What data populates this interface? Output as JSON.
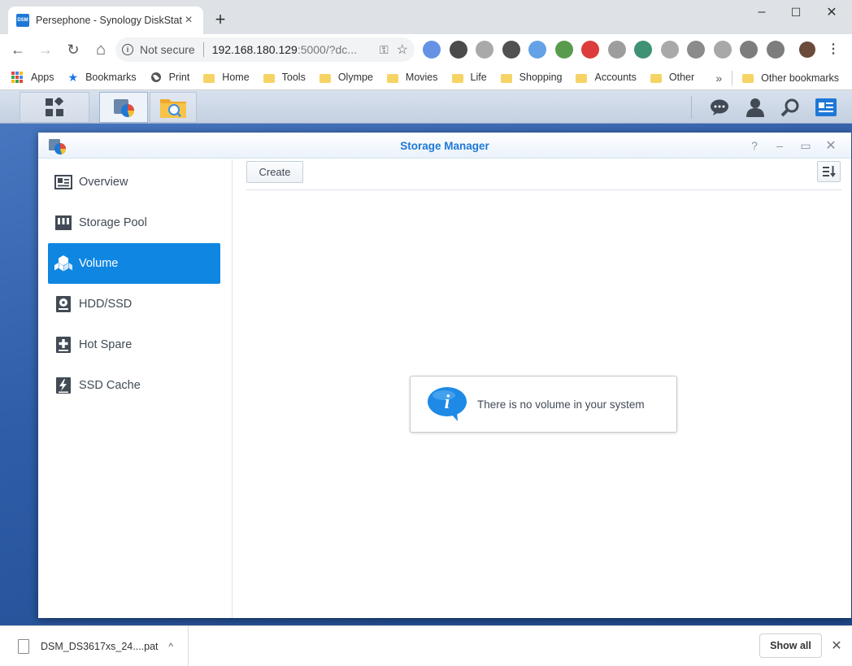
{
  "browser": {
    "tab_title": "Persephone - Synology DiskStation",
    "tab_favicon_label": "DSM",
    "tab_close": "×",
    "new_tab": "+",
    "window_controls": [
      "–",
      "☐",
      "✕"
    ],
    "nav": {
      "back": "←",
      "forward": "→",
      "reload": "↻",
      "home": "⌂"
    },
    "security_label": "Not secure",
    "url_host": "192.168.180.129",
    "url_rest": ":5000/?dc...",
    "key_icon": "⚿",
    "star_icon": "☆",
    "menu_icon": "⋮",
    "extensions": [
      {
        "icon": "google-translate-icon",
        "color": "#4a7fe0"
      },
      {
        "icon": "amazon-icon",
        "color": "#2b2b2b"
      },
      {
        "icon": "hand-icon",
        "color": "#9a9a9a"
      },
      {
        "icon": "sb-icon",
        "color": "#333333"
      },
      {
        "icon": "pulse-icon",
        "color": "#4a90e2"
      },
      {
        "icon": "globe-badge-icon",
        "color": "#3c8a2e"
      },
      {
        "icon": "opera-icon",
        "color": "#d61a1a"
      },
      {
        "icon": "search-doc-icon",
        "color": "#8c8c8c"
      },
      {
        "icon": "s-green-icon",
        "color": "#1d7f5a"
      },
      {
        "icon": "window-icon",
        "color": "#9a9a9a"
      },
      {
        "icon": "recycle-icon",
        "color": "#777777"
      },
      {
        "icon": "skype-icon",
        "color": "#999999"
      },
      {
        "icon": "puzzle-icon",
        "color": "#666666"
      },
      {
        "icon": "cast-icon",
        "color": "#666666"
      }
    ]
  },
  "bookmarks": {
    "items": [
      "Apps",
      "Bookmarks",
      "Print",
      "Home",
      "Tools",
      "Olympe",
      "Movies",
      "Life",
      "Shopping",
      "Accounts",
      "Other"
    ],
    "overflow": "»",
    "other_bookmarks": "Other bookmarks"
  },
  "dsm": {
    "window_title": "Storage Manager",
    "window_controls": [
      "?",
      "–",
      "▭",
      "✕"
    ],
    "sidebar": [
      {
        "label": "Overview",
        "icon": "overview-icon",
        "active": false
      },
      {
        "label": "Storage Pool",
        "icon": "storage-pool-icon",
        "active": false
      },
      {
        "label": "Volume",
        "icon": "volume-icon",
        "active": true
      },
      {
        "label": "HDD/SSD",
        "icon": "hdd-icon",
        "active": false
      },
      {
        "label": "Hot Spare",
        "icon": "hot-spare-icon",
        "active": false
      },
      {
        "label": "SSD Cache",
        "icon": "ssd-cache-icon",
        "active": false
      }
    ],
    "create_label": "Create",
    "empty_message": "There is no volume in your system",
    "accent_color": "#0f86e2"
  },
  "downloads": {
    "file_name": "DSM_DS3617xs_24....pat",
    "chevron": "^",
    "show_all": "Show all",
    "close": "✕"
  }
}
